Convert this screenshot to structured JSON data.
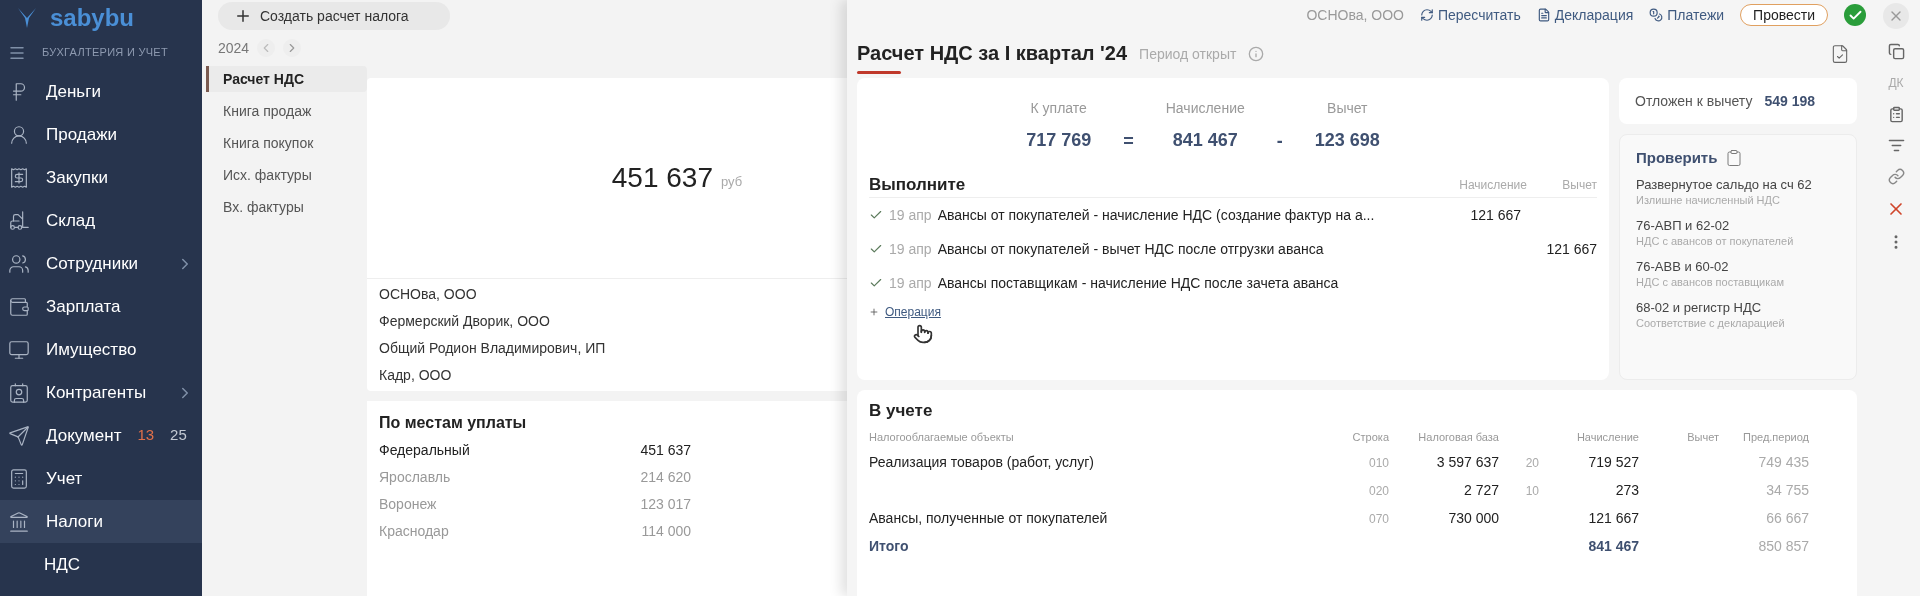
{
  "sidebar": {
    "logo": "sabybu",
    "section": "БУХГАЛТЕРИЯ И УЧЕТ",
    "items": [
      {
        "label": "Деньги",
        "selected": false,
        "has_submenu": false
      },
      {
        "label": "Продажи",
        "selected": false,
        "has_submenu": false
      },
      {
        "label": "Закупки",
        "selected": false,
        "has_submenu": false
      },
      {
        "label": "Склад",
        "selected": false,
        "has_submenu": false
      },
      {
        "label": "Сотрудники",
        "selected": false,
        "has_submenu": true
      },
      {
        "label": "Зарплата",
        "selected": false,
        "has_submenu": false
      },
      {
        "label": "Имущество",
        "selected": false,
        "has_submenu": false
      },
      {
        "label": "Контрагенты",
        "selected": false,
        "has_submenu": true
      },
      {
        "label": "Документ",
        "selected": false,
        "has_submenu": false,
        "badges": [
          {
            "text": "13",
            "color": "#e0704a"
          },
          {
            "text": "25",
            "color": "#c3c9d3"
          }
        ]
      },
      {
        "label": "Учет",
        "selected": false,
        "has_submenu": false
      },
      {
        "label": "Налоги",
        "selected": true,
        "has_submenu": false
      }
    ],
    "subitem": "НДС"
  },
  "toolbar": {
    "create_button": "Создать расчет налога",
    "year": "2024"
  },
  "nav": [
    {
      "label": "Расчет НДС",
      "selected": true
    },
    {
      "label": "Книга продаж",
      "selected": false
    },
    {
      "label": "Книга покупок",
      "selected": false
    },
    {
      "label": "Исх. фактуры",
      "selected": false
    },
    {
      "label": "Вх. фактуры",
      "selected": false
    }
  ],
  "summary_card": {
    "amount": "451 637",
    "unit": "руб",
    "companies": [
      "ОСНОва, ООО",
      "Фермерский Дворик, ООО",
      "Общий Родион Владимирович, ИП",
      "Кадр, ООО"
    ]
  },
  "payment_places": {
    "title": "По местам уплаты",
    "rows": [
      {
        "kind": "total",
        "name": "Федеральный",
        "amount": "451 637"
      },
      {
        "kind": "region",
        "name": "Ярославль",
        "amount": "214 620"
      },
      {
        "kind": "region",
        "name": "Воронеж",
        "amount": "123 017"
      },
      {
        "kind": "region",
        "name": "Краснодар",
        "amount": "114 000"
      }
    ]
  },
  "panel": {
    "org": "ОСНОва, ООО",
    "actions": [
      "Пересчитать",
      "Декларация",
      "Платежи"
    ],
    "post_button": "Провести",
    "posted": true,
    "title": "Расчет НДС за I квартал '24",
    "period_status": "Период открыт",
    "totals": [
      {
        "label": "К уплате",
        "value": "717 769"
      },
      {
        "label": "Начисление",
        "value": "841 467"
      },
      {
        "label": "Вычет",
        "value": "123 698"
      }
    ],
    "operators": [
      "=",
      "-"
    ],
    "tasks": {
      "title": "Выполните",
      "columns": [
        "Начисление",
        "Вычет"
      ],
      "rows": [
        {
          "done": true,
          "date": "19 апр",
          "text": "Авансы от покупателей - начисление НДС (создание фактур на а...",
          "accrual": "121 667"
        },
        {
          "done": true,
          "date": "19 апр",
          "text": "Авансы от покупателей - вычет НДС после отгрузки аванса",
          "deduction": "121 667"
        },
        {
          "done": true,
          "date": "19 апр",
          "text": "Авансы поставщикам - начисление НДС после зачета аванса"
        }
      ],
      "add_link": "Операция"
    },
    "deferred": {
      "label": "Отложен к вычету",
      "value": "549 198"
    },
    "checks": {
      "title": "Проверить",
      "items": [
        {
          "title": "Развернутое сальдо на сч 62",
          "subtitle": "Излишне начисленный НДС"
        },
        {
          "title": "76-АВП и 62-02",
          "subtitle": "НДС с авансов от покупателей"
        },
        {
          "title": "76-АВВ и 60-02",
          "subtitle": "НДС с авансов поставщикам"
        },
        {
          "title": "68-02 и регистр НДС",
          "subtitle": "Соответствие с декларацией"
        }
      ]
    },
    "ledger": {
      "title": "В учете",
      "columns": [
        "Налогооблагаемые объекты",
        "Строка",
        "Налоговая база",
        "Начисление",
        "Вычет",
        "Пред.период"
      ],
      "rows": [
        {
          "name": "Реализация товаров (работ, услуг)",
          "line": "010",
          "base": "3 597 637",
          "rate": "20",
          "accrual": "719 527",
          "previous": "749 435"
        },
        {
          "line": "020",
          "base": "2 727",
          "rate": "10",
          "accrual": "273",
          "previous": "34 755"
        },
        {
          "name": "Авансы, полученные от покупателей",
          "line": "070",
          "base": "730 000",
          "accrual": "121 667",
          "previous": "66 667"
        }
      ],
      "total": {
        "label": "Итого",
        "accrual": "841 467",
        "previous": "850 857"
      }
    },
    "side_toolbar": {
      "dk": "ДК"
    }
  }
}
